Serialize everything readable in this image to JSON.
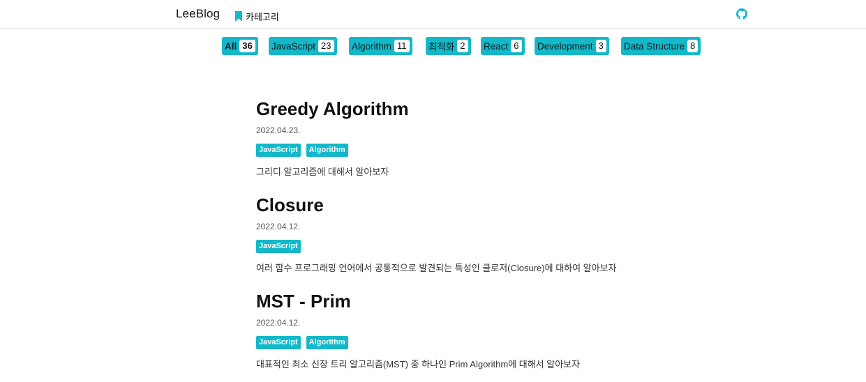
{
  "header": {
    "brand": "LeeBlog",
    "category_link": "카테고리",
    "github_icon": "github-icon",
    "bookmark_icon": "bookmark-icon",
    "accent_color": "#14b8c8"
  },
  "categories": [
    {
      "label": "All",
      "count": "36",
      "active": true
    },
    {
      "label": "JavaScript",
      "count": "23"
    },
    {
      "label": "Algorithm",
      "count": "11"
    },
    {
      "label": "최적화",
      "count": "2"
    },
    {
      "label": "React",
      "count": "6"
    },
    {
      "label": "Development",
      "count": "3"
    },
    {
      "label": "Data Structure",
      "count": "8"
    }
  ],
  "posts": [
    {
      "title": "Greedy Algorithm",
      "date": "2022.04.23.",
      "tags": [
        "JavaScript",
        "Algorithm"
      ],
      "description": "그리디 알고리즘에 대해서 알아보자"
    },
    {
      "title": "Closure",
      "date": "2022.04.12.",
      "tags": [
        "JavaScript"
      ],
      "description": "여러 함수 프로그래밍 언어에서 공통적으로 발견되는 특성인 클로저(Closure)에 대하여 알아보자"
    },
    {
      "title": "MST - Prim",
      "date": "2022.04.12.",
      "tags": [
        "JavaScript",
        "Algorithm"
      ],
      "description": "대표적인 최소 신장 트리 알고리즘(MST) 중 하나인 Prim Algorithm에 대해서 알아보자"
    }
  ]
}
